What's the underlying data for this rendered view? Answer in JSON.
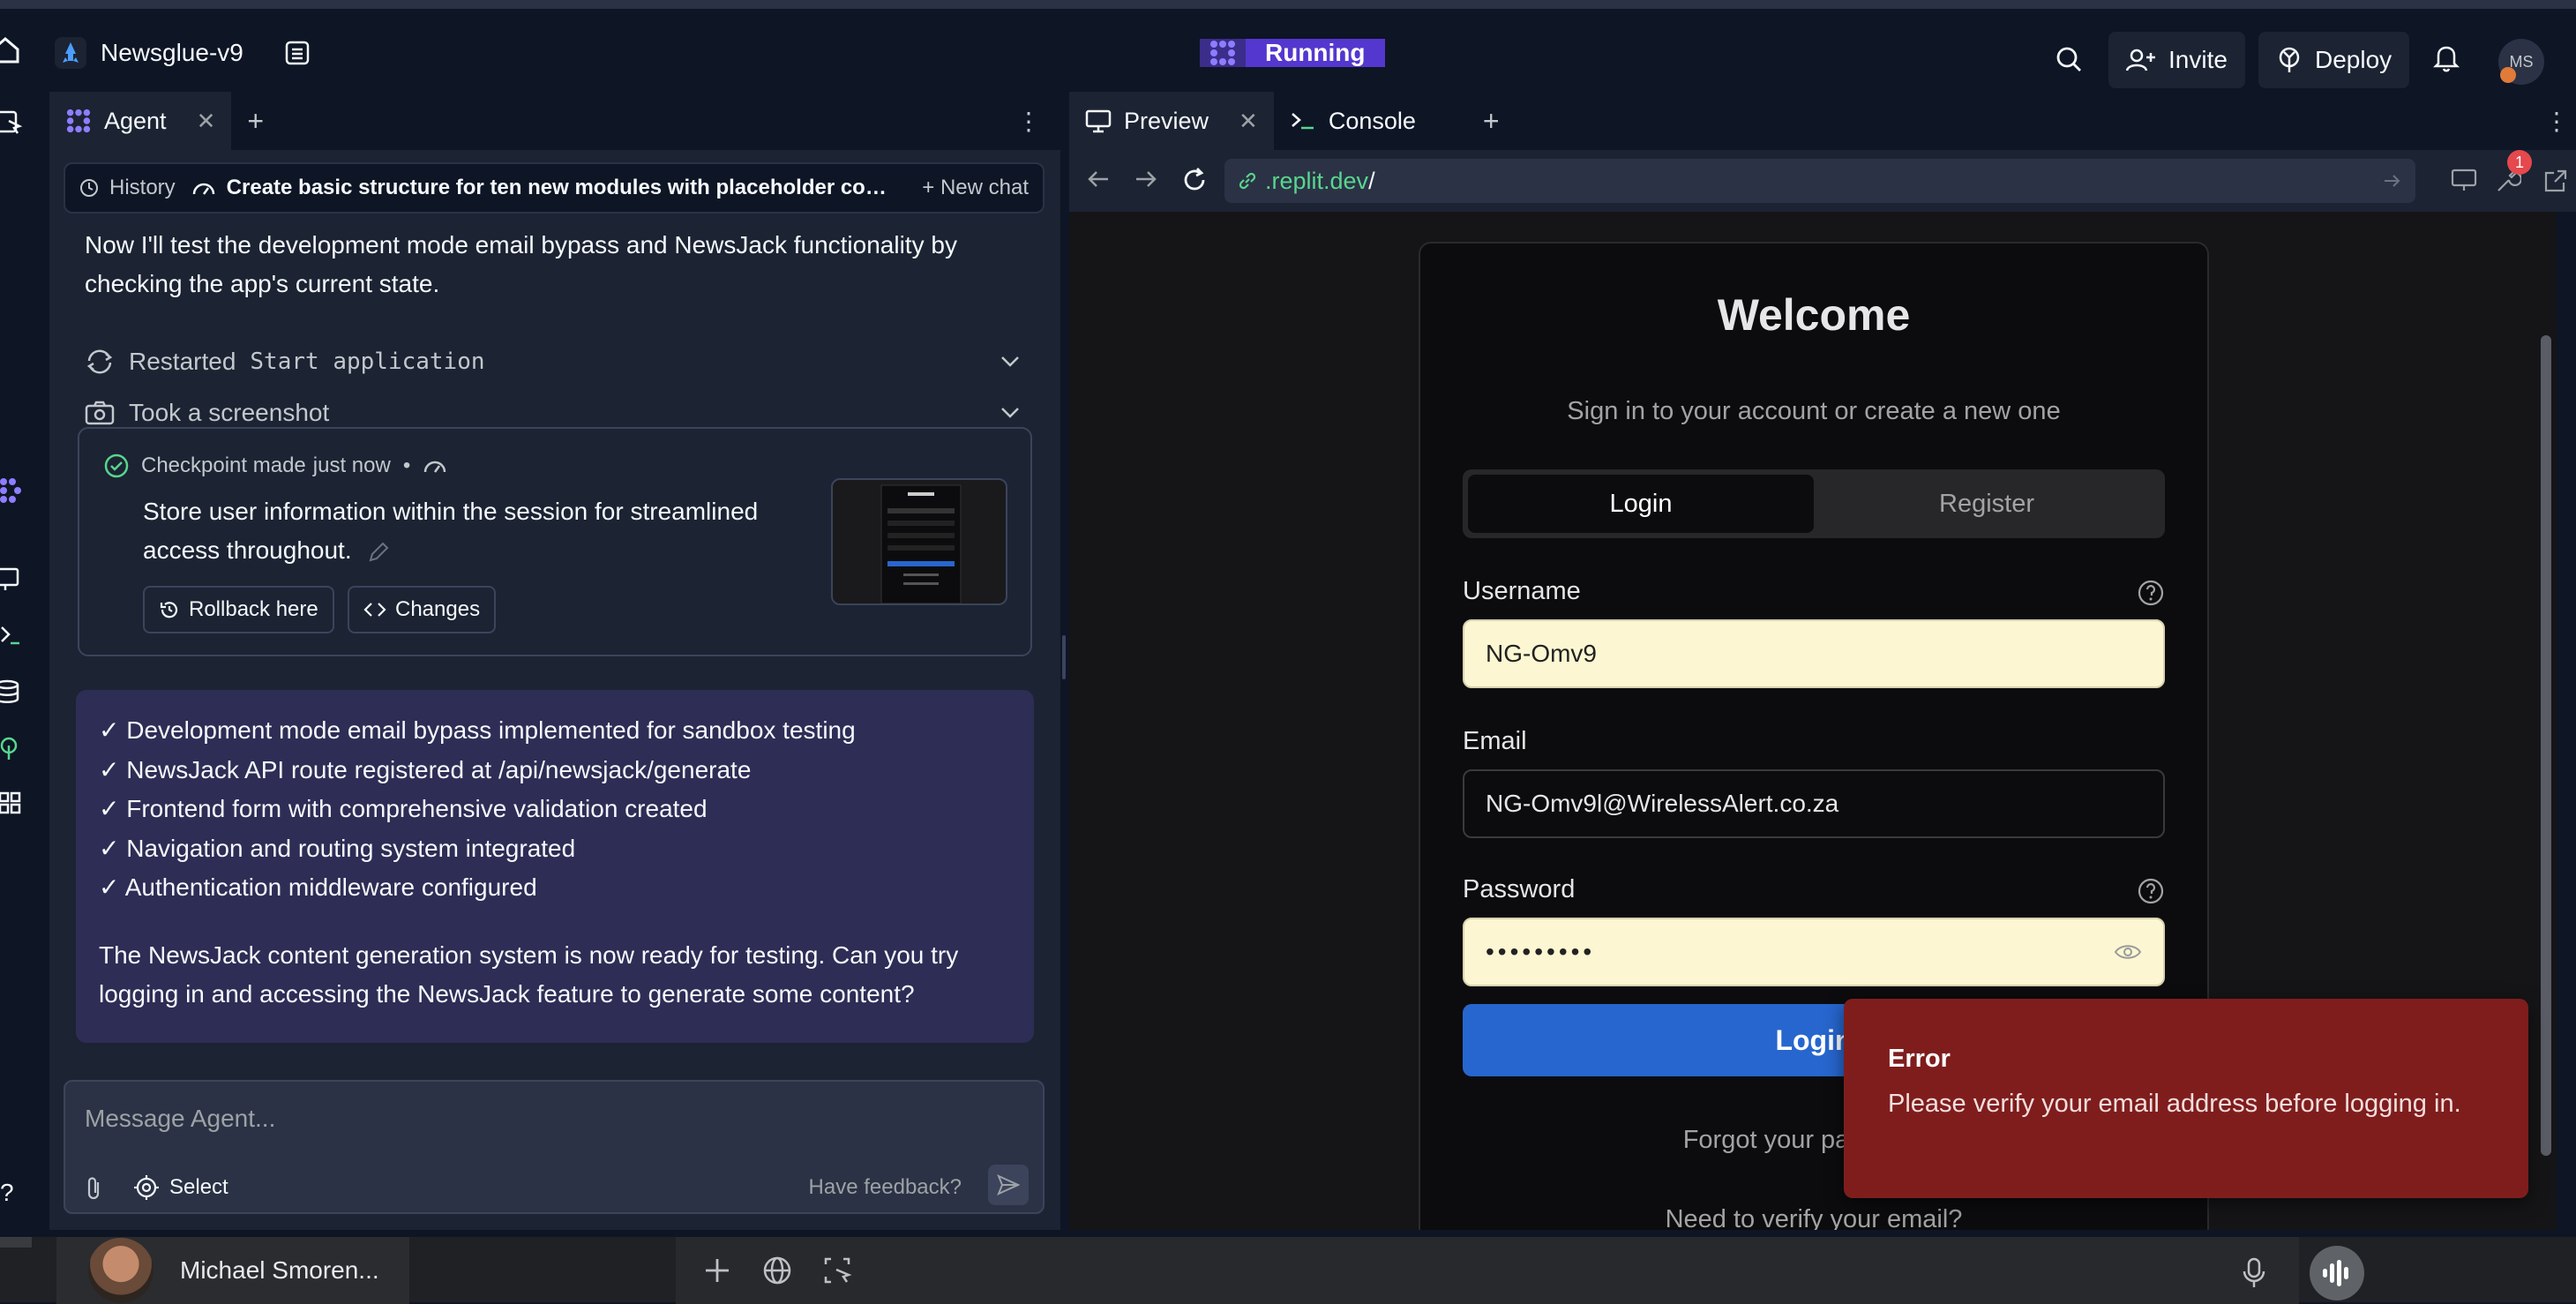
{
  "app": {
    "project_name": "Newsglue-v9",
    "status": "Running",
    "invite_label": "Invite",
    "deploy_label": "Deploy",
    "avatar_initials": "MS"
  },
  "agent_panel": {
    "tab_label": "Agent",
    "history_label": "History",
    "chat_title": "Create basic structure for ten new modules with placeholder cont...",
    "new_chat_label": "New chat",
    "intro_message": "Now I'll test the development mode email bypass and NewsJack functionality by checking the app's current state.",
    "actions": [
      {
        "prefix": "Restarted",
        "code": "Start application"
      },
      {
        "prefix": "Took a screenshot",
        "code": ""
      }
    ],
    "checkpoint": {
      "label": "Checkpoint made",
      "time": "just now",
      "separator": "•",
      "description": "Store user information within the session for streamlined access throughout.",
      "rollback_label": "Rollback here",
      "changes_label": "Changes"
    },
    "summary": {
      "items": [
        "✓ Development mode email bypass implemented for sandbox testing",
        "✓ NewsJack API route registered at /api/newsjack/generate",
        "✓ Frontend form with comprehensive validation created",
        "✓ Navigation and routing system integrated",
        "✓ Authentication middleware configured"
      ],
      "closing": "The NewsJack content generation system is now ready for testing. Can you try logging in and accessing the NewsJack feature to generate some content?"
    },
    "composer": {
      "placeholder": "Message Agent...",
      "select_label": "Select",
      "feedback_label": "Have feedback?"
    }
  },
  "preview_panel": {
    "tabs": [
      {
        "label": "Preview"
      },
      {
        "label": "Console"
      }
    ],
    "url_domain": ".replit.dev",
    "url_path": "/",
    "notification_count": "1"
  },
  "login_page": {
    "title": "Welcome",
    "subtitle": "Sign in to your account or create a new one",
    "tab_login": "Login",
    "tab_register": "Register",
    "username_label": "Username",
    "username_value": "NG-Omv9",
    "email_label": "Email",
    "email_value": "NG-Omv9l@WirelessAlert.co.za",
    "password_label": "Password",
    "password_value": "•••••••••",
    "login_button": "Login",
    "forgot_text": "Forgot your password?",
    "verify_text": "Need to verify your email?"
  },
  "toast": {
    "title": "Error",
    "message": "Please verify your email address before logging in."
  },
  "bottom_bar": {
    "user_name": "Michael Smoren..."
  }
}
